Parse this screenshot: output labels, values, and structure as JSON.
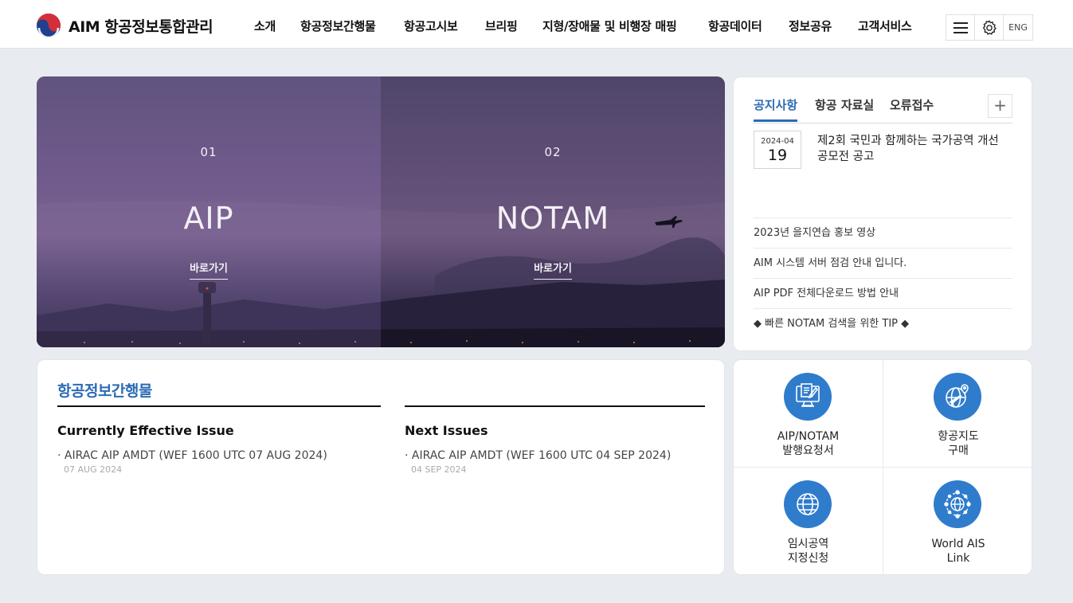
{
  "header": {
    "logo_text": "AIM 항공정보통합관리",
    "nav": [
      "소개",
      "항공정보간행물",
      "항공고시보",
      "브리핑",
      "지형/장애물 및 비행장 매핑",
      "항공데이터",
      "정보공유",
      "고객서비스"
    ],
    "menu_icon": "hamburger-icon",
    "settings_icon": "gear-icon",
    "lang_label": "ENG"
  },
  "hero": [
    {
      "num": "01",
      "title": "AIP",
      "link": "바로가기"
    },
    {
      "num": "02",
      "title": "NOTAM",
      "link": "바로가기"
    }
  ],
  "notice": {
    "tabs": [
      "공지사항",
      "항공 자료실",
      "오류접수"
    ],
    "active_tab": "공지사항",
    "plus": "+",
    "featured": {
      "date_ym": "2024-04",
      "date_d": "19",
      "title": "제2회 국민과 함께하는 국가공역 개선 공모전 공고"
    },
    "items": [
      "2023년 을지연습 홍보 영상",
      "AIM 시스템 서버 점검 안내 입니다.",
      "AIP PDF 전체다운로드 방법 안내",
      "◆ 빠른 NOTAM 검색을 위한 TIP ◆"
    ]
  },
  "publications": {
    "title": "항공정보간행물",
    "current": {
      "heading": "Currently Effective Issue",
      "item": "· AIRAC AIP AMDT (WEF 1600 UTC 07 AUG 2024)",
      "date": "07 AUG 2024"
    },
    "next": {
      "heading": "Next Issues",
      "item": "· AIRAC AIP AMDT (WEF 1600 UTC 04 SEP 2024)",
      "date": "04 SEP 2024"
    }
  },
  "quick_links": [
    {
      "label": "AIP/NOTAM\n발행요청서",
      "icon": "document-request-icon"
    },
    {
      "label": "항공지도\n구매",
      "icon": "airplane-globe-icon"
    },
    {
      "label": "임시공역\n지정신청",
      "icon": "globe-icon"
    },
    {
      "label": "World AIS\nLink",
      "icon": "network-globe-icon"
    }
  ],
  "colors": {
    "accent": "#2b6bb3",
    "icon_bg": "#2f7ccc",
    "page_bg": "#e8ecf1"
  }
}
